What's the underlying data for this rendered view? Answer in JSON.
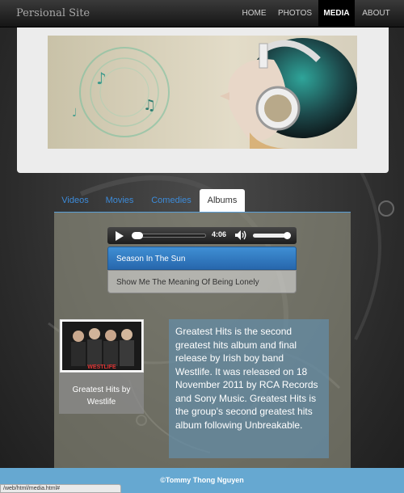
{
  "brand": "Persional Site",
  "nav": {
    "items": [
      {
        "label": "HOME",
        "active": false
      },
      {
        "label": "PHOTOS",
        "active": false
      },
      {
        "label": "MEDIA",
        "active": true
      },
      {
        "label": "ABOUT",
        "active": false
      }
    ]
  },
  "tabs": [
    {
      "label": "Videos",
      "active": false
    },
    {
      "label": "Movies",
      "active": false
    },
    {
      "label": "Comedies",
      "active": false
    },
    {
      "label": "Albums",
      "active": true
    }
  ],
  "player": {
    "time": "4:06",
    "progress": 0.0,
    "volume": 0.9
  },
  "tracks": [
    {
      "title": "Season In The Sun",
      "selected": true
    },
    {
      "title": "Show Me The Meaning Of Being Lonely",
      "selected": false
    }
  ],
  "album": {
    "cover_text": "WESTLIFE",
    "caption": "Greatest Hits by Westlife"
  },
  "description": "Greatest Hits is the second greatest hits album and final release by Irish boy band Westlife. It was released on 18 November 2011 by RCA Records and Sony Music. Greatest Hits is the group's second greatest hits album following Unbreakable.",
  "footer": "©Tommy Thong Nguyen",
  "status_url": "/web/html/media.html#",
  "colors": {
    "accent": "#3d8bd9",
    "footer": "#66a8d1",
    "nav_active": "#000000"
  }
}
